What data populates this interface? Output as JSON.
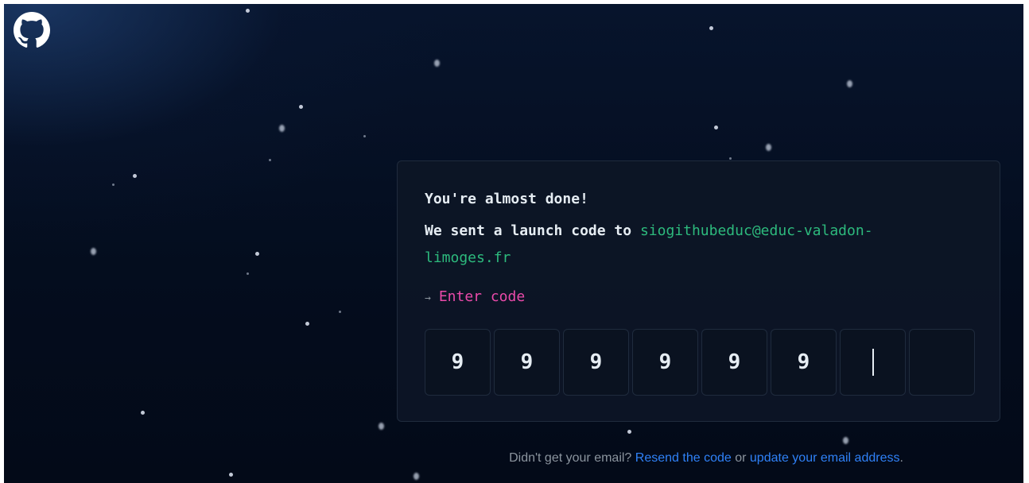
{
  "logo": {
    "icon": "github-octocat-icon"
  },
  "card": {
    "headline": "You're almost done!",
    "message_prefix": "We sent a launch code to",
    "email": "siogithubeduc@educ-valadon-limoges.fr",
    "prompt_arrow": "→",
    "prompt_label": "Enter code",
    "code_digits": [
      "9",
      "9",
      "9",
      "9",
      "9",
      "9",
      "",
      ""
    ],
    "active_digit_index": 6
  },
  "footer": {
    "question": "Didn't get your email?",
    "resend_link": "Resend the code",
    "or_text": "or",
    "update_link": "update your email address",
    "period": "."
  },
  "colors": {
    "background": "#040d1e",
    "accent_green": "#2dba7d",
    "accent_pink": "#ea4aaa",
    "link_blue": "#2f81f7"
  }
}
